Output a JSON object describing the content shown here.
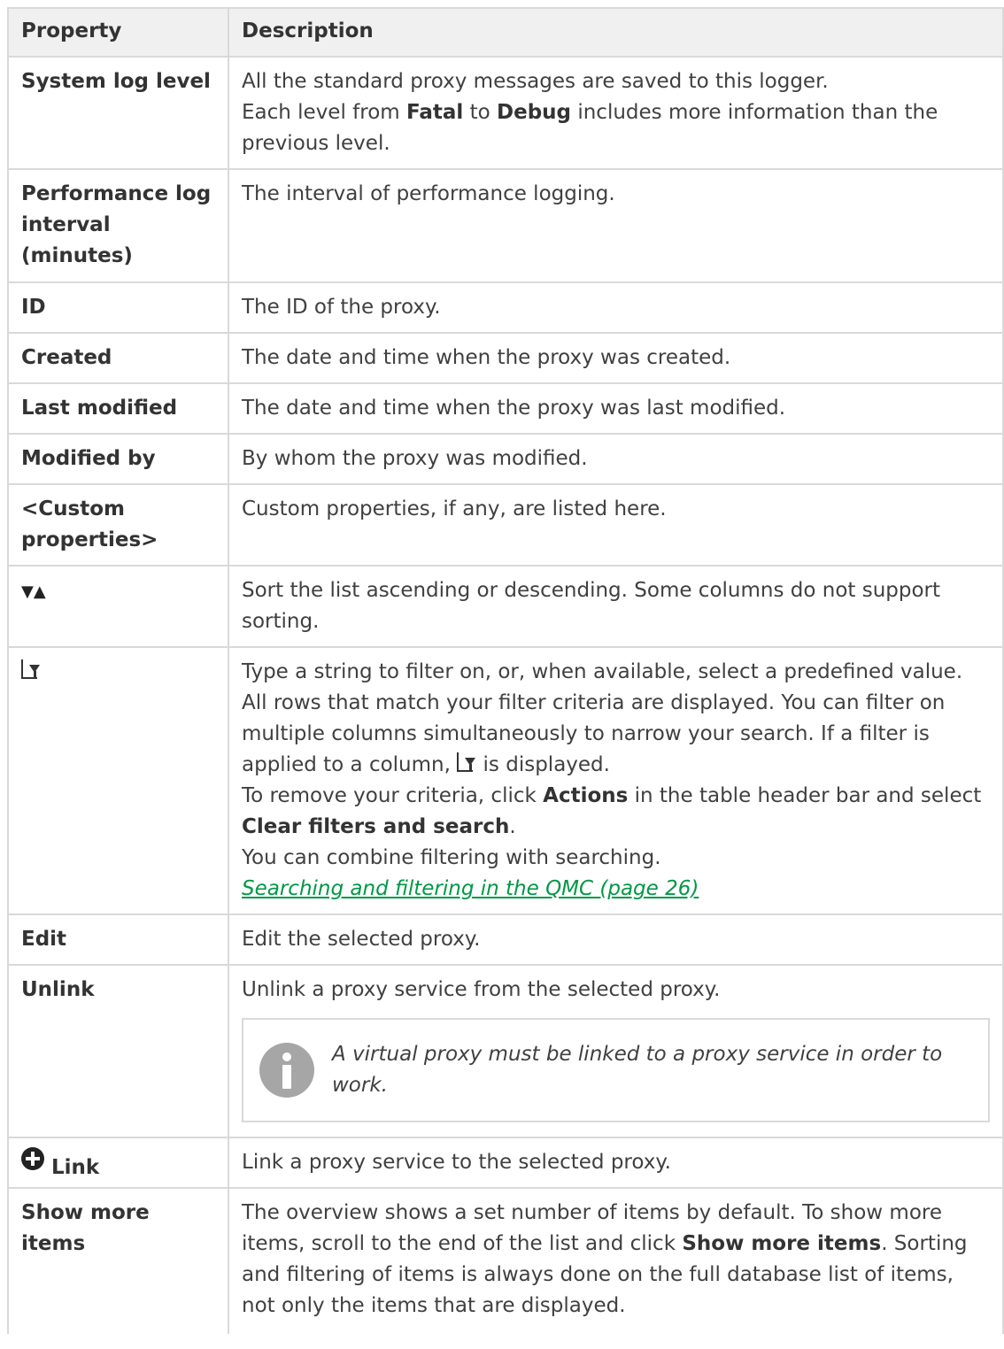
{
  "header": {
    "property": "Property",
    "description": "Description"
  },
  "rows": {
    "system_log": {
      "prop": "System log level",
      "line1": "All the standard proxy messages are saved to this logger.",
      "line2_a": "Each level from ",
      "line2_fatal": "Fatal",
      "line2_b": " to ",
      "line2_debug": "Debug",
      "line2_c": " includes more information than the previous level."
    },
    "perf": {
      "prop": "Performance log interval (minutes)",
      "desc": "The interval of performance logging."
    },
    "id": {
      "prop": "ID",
      "desc": "The ID of the proxy."
    },
    "created": {
      "prop": "Created",
      "desc": "The date and time when the proxy was created."
    },
    "modified": {
      "prop": "Last modified",
      "desc": "The date and time when the proxy was last modified."
    },
    "modified_by": {
      "prop": "Modified by",
      "desc": "By whom the proxy was modified."
    },
    "custom": {
      "prop": "<Custom properties>",
      "desc": "Custom properties, if any, are listed here."
    },
    "sort": {
      "icon": "▼▲",
      "desc": "Sort the list ascending or descending. Some columns do not support sorting."
    },
    "filter": {
      "p1": "Type a string to filter on, or, when available, select a predefined value. All rows that match your filter criteria are displayed. You can filter on multiple columns simultaneously to narrow your search. If a filter is applied to a column, ",
      "p1_end": " is displayed.",
      "p2_a": "To remove your criteria, click ",
      "p2_actions": "Actions",
      "p2_b": " in the table header bar and select ",
      "p2_clear": "Clear filters and search",
      "p2_c": ".",
      "p3": "You can combine filtering with searching.",
      "link": " Searching and filtering in the QMC (page 26)"
    },
    "edit": {
      "prop": "Edit",
      "desc": "Edit the selected proxy."
    },
    "unlink": {
      "prop": "Unlink",
      "desc": "Unlink a proxy service from the selected proxy.",
      "note": "A virtual proxy must be linked to a proxy service in order to work."
    },
    "link": {
      "prop": "Link",
      "desc": "Link a proxy service to the selected proxy."
    },
    "show_more": {
      "prop": "Show more items",
      "desc_a": "The overview shows a set number of items by default. To show more items, scroll to the end of the list and click ",
      "desc_bold": "Show more items",
      "desc_b": ". Sorting and filtering of items is always done on the full database list of items, not only the items that are displayed."
    }
  },
  "icons": {
    "sort": "sort-arrows-icon",
    "filter": "filter-icon",
    "info": "info-icon",
    "add": "plus-circle-icon"
  },
  "colors": {
    "link": "#009845",
    "border": "#d9d9d9",
    "header_bg": "#f0f0f0"
  }
}
